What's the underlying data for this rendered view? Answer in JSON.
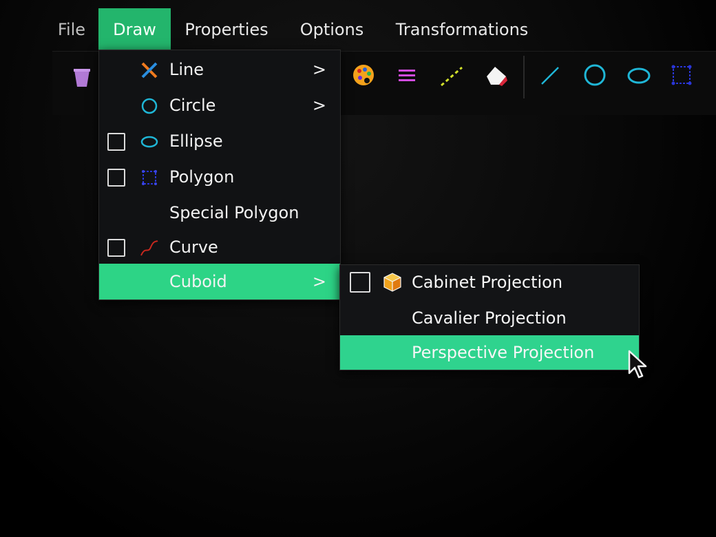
{
  "menubar": {
    "file": "File",
    "draw": "Draw",
    "properties": "Properties",
    "options": "Options",
    "transformations": "Transformations"
  },
  "toolbar": {
    "icons": [
      "bucket-icon",
      "palette-icon",
      "line-width-icon",
      "dashed-line-icon",
      "eraser-icon",
      "line-tool-icon",
      "circle-tool-icon",
      "ellipse-tool-icon",
      "polygon-tool-icon"
    ]
  },
  "draw_menu": {
    "items": [
      {
        "label": "Line",
        "icon": "line-icon",
        "checkbox": false,
        "submenu": true
      },
      {
        "label": "Circle",
        "icon": "circle-icon",
        "checkbox": false,
        "submenu": true
      },
      {
        "label": "Ellipse",
        "icon": "ellipse-icon",
        "checkbox": true,
        "submenu": false
      },
      {
        "label": "Polygon",
        "icon": "polygon-icon",
        "checkbox": true,
        "submenu": false
      },
      {
        "label": "Special Polygon",
        "icon": "",
        "checkbox": false,
        "submenu": false
      },
      {
        "label": "Curve",
        "icon": "curve-icon",
        "checkbox": true,
        "submenu": false
      },
      {
        "label": "Cuboid",
        "icon": "",
        "checkbox": false,
        "submenu": true,
        "highlighted": true
      }
    ],
    "arrow": ">"
  },
  "cuboid_submenu": {
    "items": [
      {
        "label": "Cabinet Projection",
        "icon": "cube-icon",
        "checkbox": true
      },
      {
        "label": "Cavalier Projection",
        "icon": "",
        "checkbox": false
      },
      {
        "label": "Perspective Projection",
        "icon": "",
        "checkbox": false,
        "highlighted": true
      }
    ]
  },
  "colors": {
    "menu_highlight": "#23b56c",
    "item_highlight": "#2dd486",
    "menu_bg": "#111214"
  }
}
